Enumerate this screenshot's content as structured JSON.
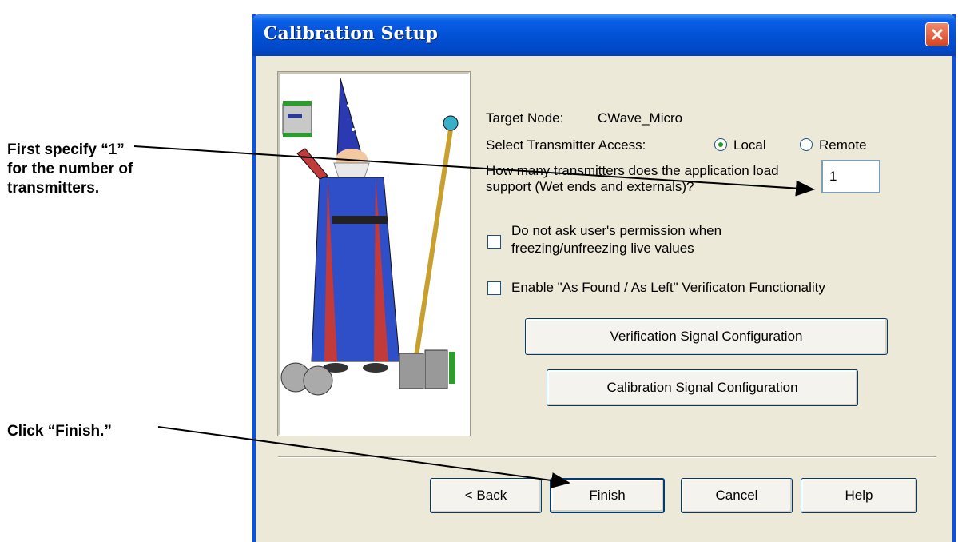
{
  "annotations": {
    "step1": "First specify “1” for the number of transmitters.",
    "step2": "Click “Finish.”"
  },
  "dialog": {
    "title": "Calibration Setup",
    "target_node_label": "Target Node:",
    "target_node_value": "CWave_Micro",
    "access_label": "Select Transmitter Access:",
    "access_options": {
      "local": "Local",
      "remote": "Remote",
      "selected": "Local"
    },
    "transmitters_question": "How many transmitters does the application load support (Wet ends and externals)?",
    "transmitters_value": "1",
    "freeze_checkbox_label": "Do not ask user's permission when freezing/unfreezing live values",
    "verification_checkbox_label": "Enable \"As Found / As Left\" Verificaton Functionality",
    "verification_button": "Verification Signal Configuration",
    "calibration_button": "Calibration Signal Configuration",
    "footer": {
      "back": "< Back",
      "finish": "Finish",
      "cancel": "Cancel",
      "help": "Help"
    }
  },
  "colors": {
    "titlebar": "#0252d6",
    "dialog_bg": "#ece9d8",
    "close_button": "#d94322"
  },
  "icons": {
    "close": "close-icon",
    "wizard": "wizard-illustration"
  }
}
